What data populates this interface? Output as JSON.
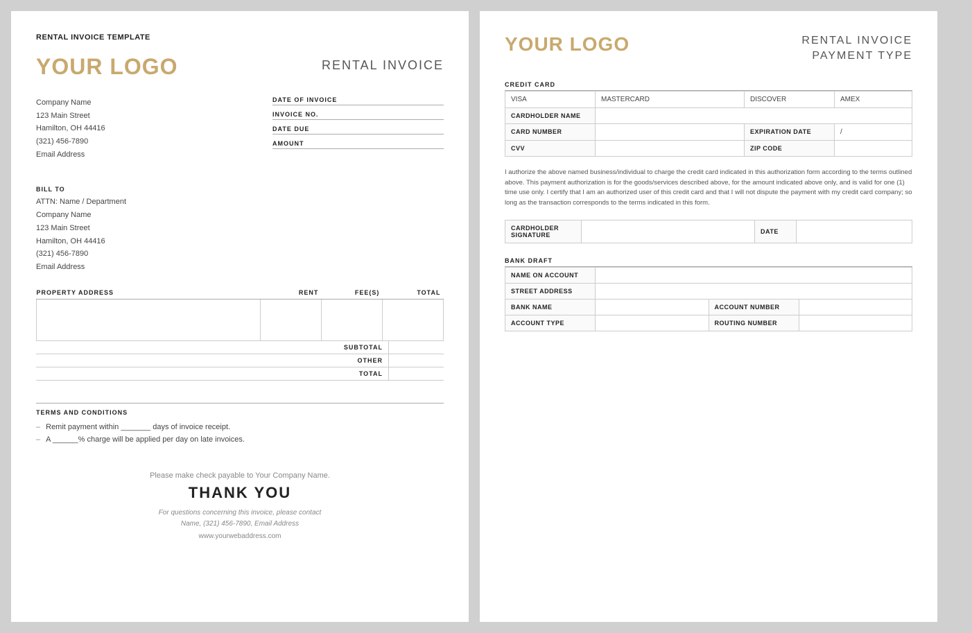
{
  "left": {
    "template_title": "RENTAL INVOICE TEMPLATE",
    "logo": "YOUR LOGO",
    "invoice_title": "RENTAL INVOICE",
    "company": {
      "name": "Company Name",
      "street": "123 Main Street",
      "city": "Hamilton, OH  44416",
      "phone": "(321) 456-7890",
      "email": "Email Address"
    },
    "invoice_fields": {
      "date_label": "DATE OF INVOICE",
      "invoice_no_label": "INVOICE NO.",
      "date_due_label": "DATE DUE",
      "amount_label": "AMOUNT"
    },
    "bill_to": {
      "label": "BILL TO",
      "attn": "ATTN: Name / Department",
      "company": "Company Name",
      "street": "123 Main Street",
      "city": "Hamilton, OH  44416",
      "phone": "(321) 456-7890",
      "email": "Email Address"
    },
    "table": {
      "headers": [
        "PROPERTY ADDRESS",
        "RENT",
        "FEE(S)",
        "TOTAL"
      ],
      "rows": [
        [
          "",
          "",
          "",
          ""
        ]
      ]
    },
    "totals": [
      {
        "label": "SUBTOTAL",
        "value": ""
      },
      {
        "label": "OTHER",
        "value": ""
      },
      {
        "label": "TOTAL",
        "value": ""
      }
    ],
    "terms": {
      "label": "TERMS AND CONDITIONS",
      "items": [
        "Remit payment within _______ days of invoice receipt.",
        "A ______% charge will be applied per day on late invoices."
      ]
    },
    "footer": {
      "check_payable": "Please make check payable to Your Company Name.",
      "thank_you": "THANK YOU",
      "contact_line1": "For questions concerning this invoice, please contact",
      "contact_line2": "Name, (321) 456-7890, Email Address",
      "website": "www.yourwebaddress.com"
    }
  },
  "right": {
    "logo": "YOUR LOGO",
    "title_line1": "RENTAL INVOICE",
    "title_line2": "PAYMENT TYPE",
    "credit_card": {
      "label": "CREDIT CARD",
      "cards": [
        "VISA",
        "MASTERCARD",
        "DISCOVER",
        "AMEX"
      ],
      "fields": [
        {
          "label": "CARDHOLDER NAME",
          "colspan": 4
        },
        {
          "label": "CARD NUMBER",
          "colspan": 2,
          "extra_label": "EXPIRATION DATE",
          "extra_value": "/"
        },
        {
          "label": "CVV",
          "colspan": 2,
          "extra_label": "ZIP CODE",
          "extra_value": ""
        }
      ]
    },
    "auth_text": "I authorize the above named business/individual to charge the credit card indicated in this authorization form according to the terms outlined above. This payment authorization is for the goods/services described above, for the amount indicated above only, and is valid for one (1) time use only. I certify that I am an authorized user of this credit card and that I will not dispute the payment with my credit card company; so long as the transaction corresponds to the terms indicated in this form.",
    "signature": {
      "label_sig": "CARDHOLDER SIGNATURE",
      "label_date": "DATE"
    },
    "bank_draft": {
      "label": "BANK DRAFT",
      "fields": [
        {
          "label": "NAME ON ACCOUNT",
          "colspan": 2
        },
        {
          "label": "STREET ADDRESS",
          "colspan": 2
        },
        {
          "label": "BANK NAME",
          "right_label": "ACCOUNT NUMBER"
        },
        {
          "label": "ACCOUNT TYPE",
          "right_label": "ROUTING NUMBER"
        }
      ]
    }
  }
}
